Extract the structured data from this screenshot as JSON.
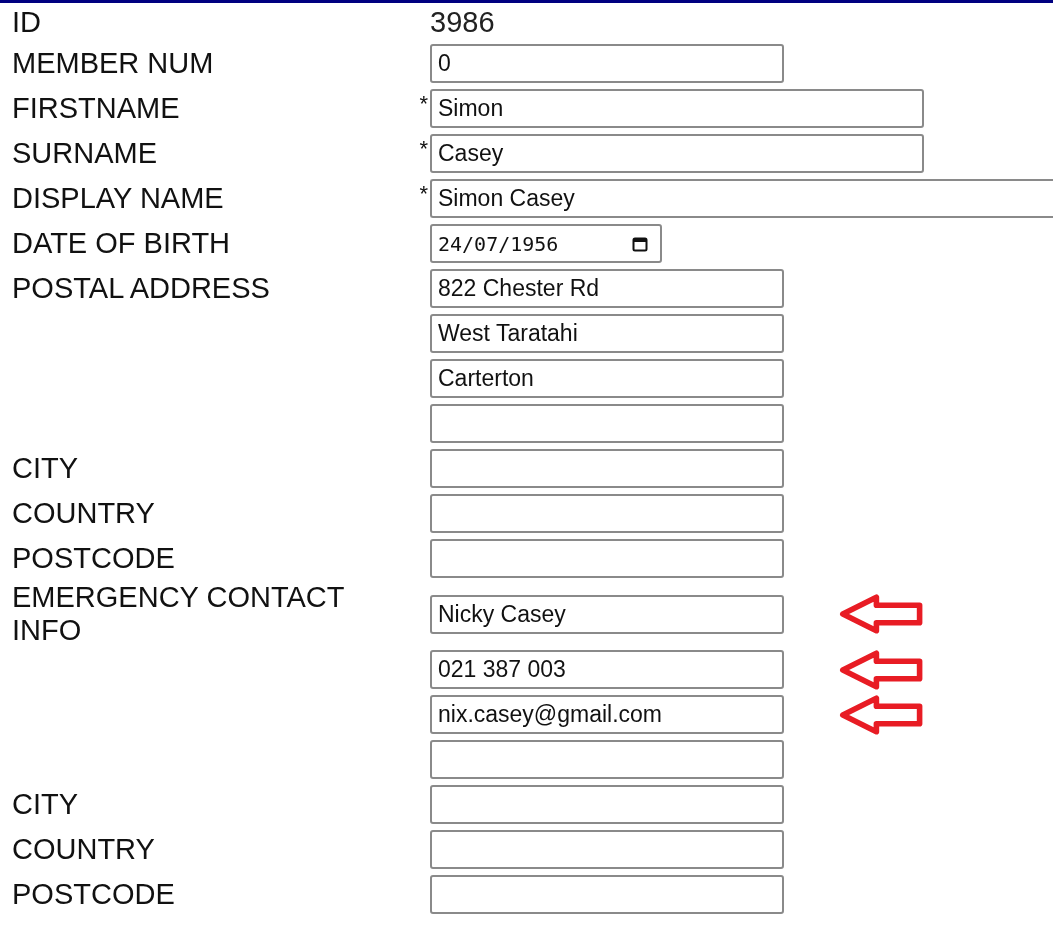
{
  "rows": [
    {
      "label": "ID",
      "value_text": "3986"
    },
    {
      "label": "MEMBER NUM",
      "field": {
        "kind": "short",
        "value": "0",
        "arrow": false
      }
    },
    {
      "label": "FIRSTNAME",
      "required_mark": "*",
      "field": {
        "kind": "long",
        "value": "Simon",
        "arrow": false
      }
    },
    {
      "label": "SURNAME",
      "required_mark": "*",
      "field": {
        "kind": "long",
        "value": "Casey",
        "arrow": false
      }
    },
    {
      "label": "DISPLAY NAME",
      "required_mark": "*",
      "field": {
        "kind": "wide",
        "value": "Simon Casey",
        "arrow": false
      }
    },
    {
      "label": "DATE OF BIRTH",
      "field": {
        "kind": "date",
        "value": "24/07/1956",
        "arrow": false
      }
    },
    {
      "label": "POSTAL ADDRESS",
      "field": {
        "kind": "short",
        "value": "822 Chester Rd",
        "arrow": false
      }
    },
    {
      "field": {
        "kind": "short",
        "value": "West Taratahi",
        "arrow": false
      }
    },
    {
      "field": {
        "kind": "short",
        "value": "Carterton",
        "arrow": false
      }
    },
    {
      "field": {
        "kind": "short",
        "arrow": false
      }
    },
    {
      "label": "CITY",
      "field": {
        "kind": "short",
        "arrow": false
      }
    },
    {
      "label": "COUNTRY",
      "field": {
        "kind": "short",
        "arrow": false
      }
    },
    {
      "label": "POSTCODE",
      "field": {
        "kind": "short",
        "arrow": false
      }
    },
    {
      "label": "EMERGENCY CONTACT INFO",
      "field": {
        "kind": "short",
        "value": "Nicky Casey",
        "arrow": true
      }
    },
    {
      "field": {
        "kind": "short",
        "value": "021 387 003",
        "arrow": true
      }
    },
    {
      "field": {
        "kind": "short",
        "value": "nix.casey@gmail.com",
        "arrow": true
      }
    },
    {
      "field": {
        "kind": "short",
        "arrow": false
      }
    },
    {
      "label": "CITY",
      "field": {
        "kind": "short",
        "arrow": false
      }
    },
    {
      "label": "COUNTRY",
      "field": {
        "kind": "short",
        "arrow": false
      }
    },
    {
      "label": "POSTCODE",
      "field": {
        "kind": "short",
        "arrow": false
      }
    }
  ]
}
